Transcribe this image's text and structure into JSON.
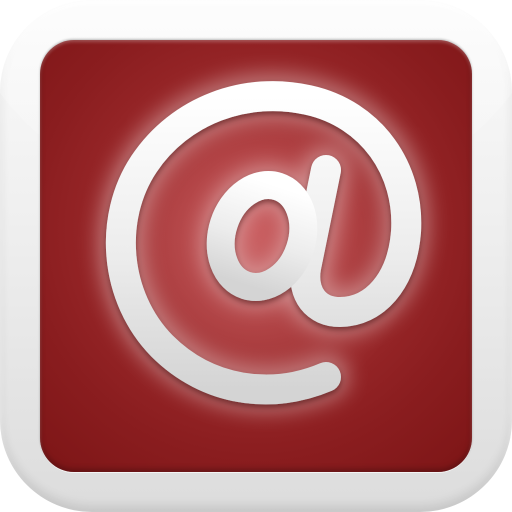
{
  "app_icon": {
    "icon": "at-sign-icon",
    "colors": {
      "tile_red": "#9d2a2c",
      "tile_red_dark": "#7d1516",
      "frame_silver": "#f0f0f0",
      "symbol_light": "#f4f4f4"
    }
  }
}
